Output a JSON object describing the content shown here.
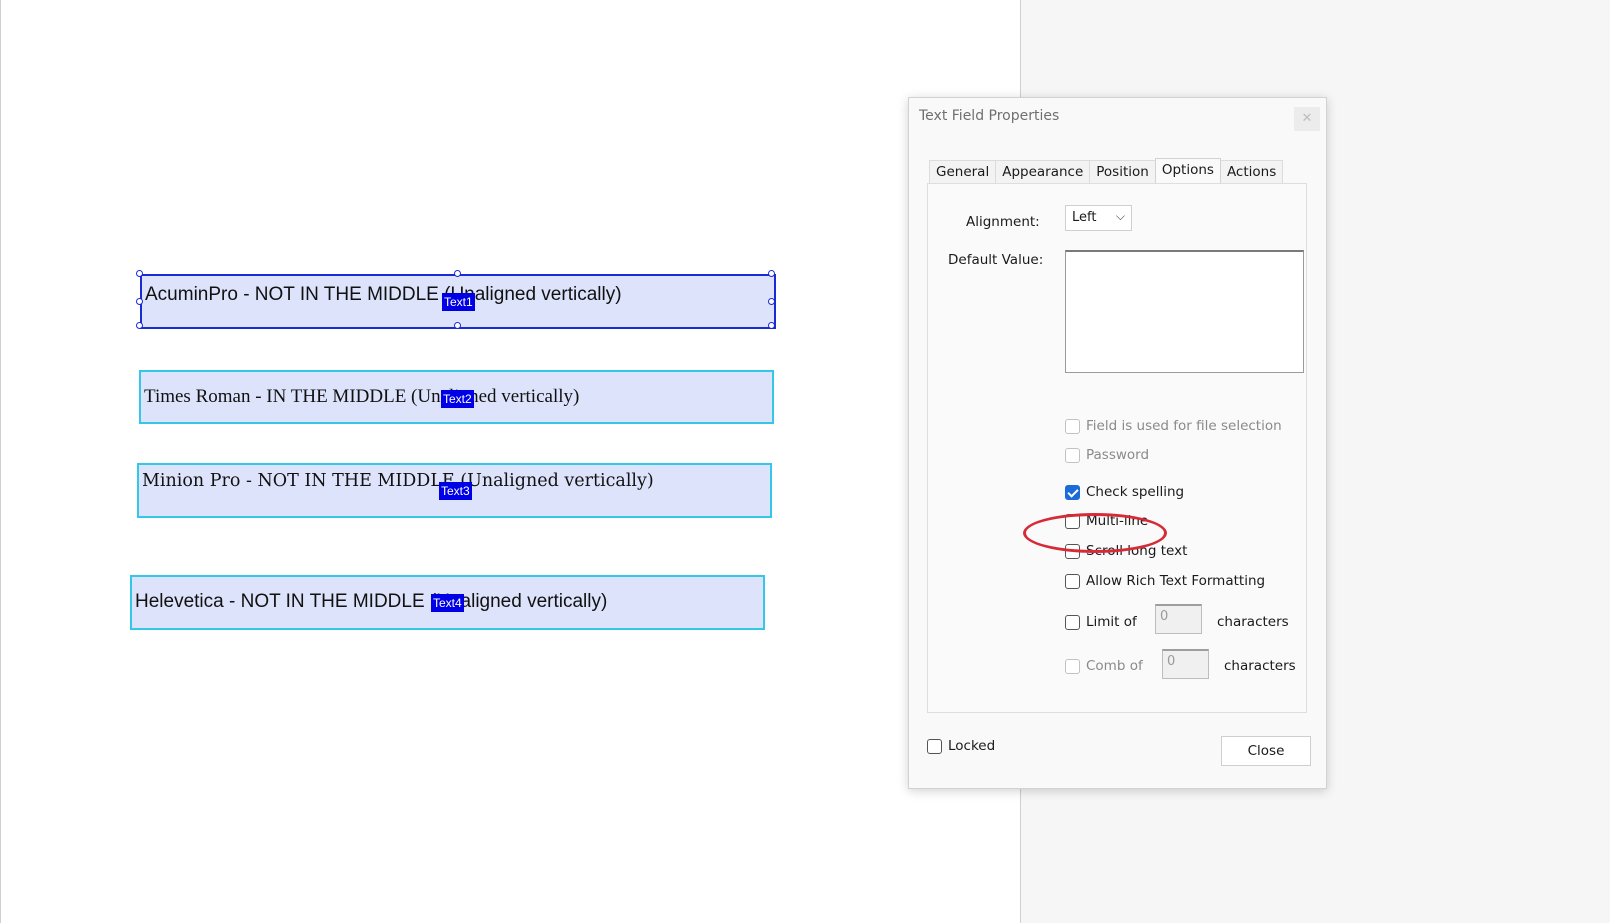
{
  "fields": [
    {
      "text": "AcuminPro - NOT IN THE MIDDLE (Unaligned vertically)",
      "tag": "Text1",
      "selected": true
    },
    {
      "text": "Times Roman - IN THE MIDDLE (Unaligned vertically)",
      "tag": "Text2",
      "selected": false
    },
    {
      "text": "Minion Pro - NOT IN THE MIDDLE (Unaligned vertically)",
      "tag": "Text3",
      "selected": false
    },
    {
      "text": "Helevetica - NOT IN THE MIDDLE (Unaligned vertically)",
      "tag": "Text4",
      "selected": false
    }
  ],
  "dialog": {
    "title": "Text Field Properties",
    "close_glyph": "✕",
    "tabs": [
      {
        "label": "General",
        "active": false
      },
      {
        "label": "Appearance",
        "active": false
      },
      {
        "label": "Position",
        "active": false
      },
      {
        "label": "Options",
        "active": true
      },
      {
        "label": "Actions",
        "active": false
      }
    ],
    "options": {
      "alignment_label": "Alignment:",
      "alignment_value": "Left",
      "default_value_label": "Default Value:",
      "default_value": "",
      "file_selection_label": "Field is used for file selection",
      "password_label": "Password",
      "check_spelling_label": "Check spelling",
      "multiline_label": "Multi-line",
      "scroll_long_text_label": "Scroll long text",
      "rich_text_label": "Allow Rich Text Formatting",
      "limit_of_label": "Limit of",
      "limit_value": "0",
      "limit_unit": "characters",
      "comb_of_label": "Comb of",
      "comb_value": "0",
      "comb_unit": "characters"
    },
    "locked_label": "Locked",
    "close_button_label": "Close"
  },
  "colors": {
    "field_fill": "#dde3fb",
    "field_border": "#33c7e8",
    "selected_border": "#1a2bd6",
    "tag_bg": "#0000e6",
    "highlight": "#d62a36",
    "checkbox_checked": "#1b6bd8"
  }
}
